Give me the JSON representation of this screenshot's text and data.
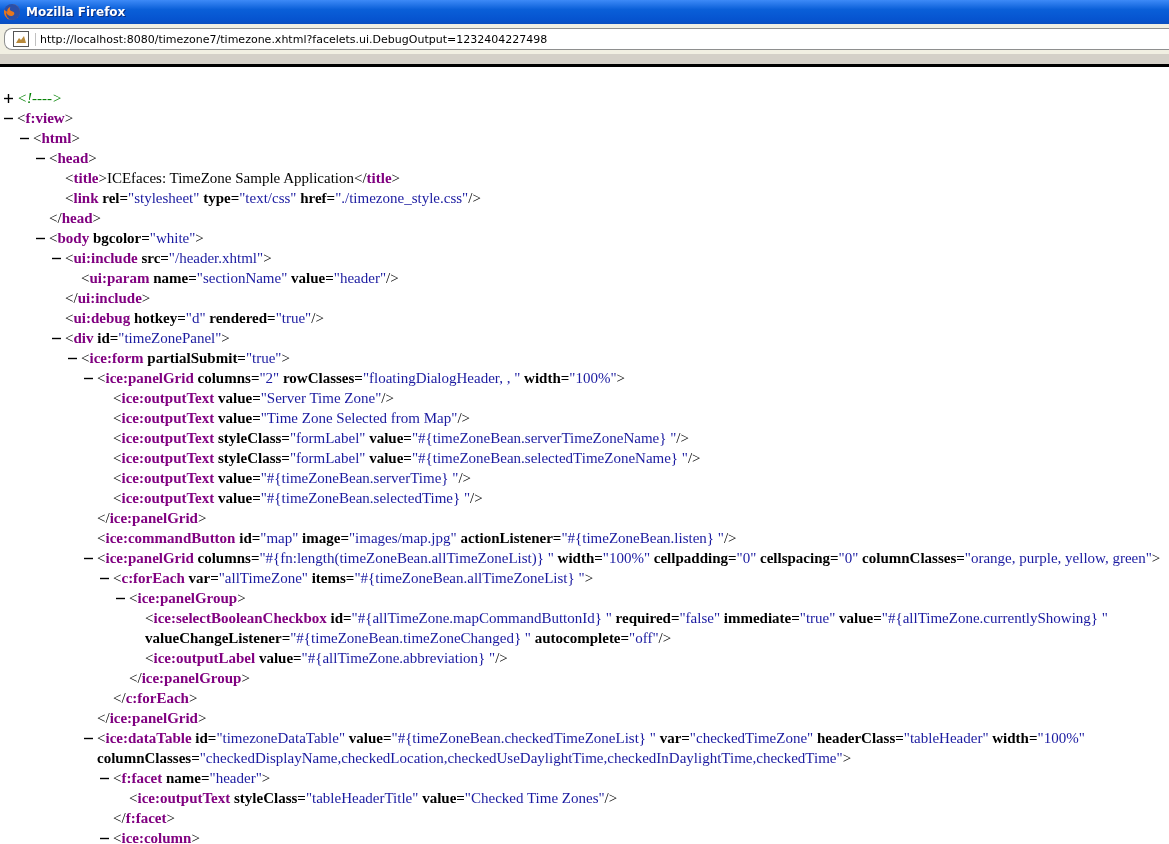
{
  "window": {
    "title": "Mozilla Firefox"
  },
  "address_bar": {
    "value": "http://localhost:8080/timezone7/timezone.xhtml?facelets.ui.DebugOutput=1232404227498"
  },
  "tree": [
    {
      "kind": "comment",
      "expanded": false,
      "open": [
        {
          "comment": "<!---->"
        }
      ]
    },
    {
      "kind": "element",
      "expanded": true,
      "open": [
        {
          "punct": "<"
        },
        {
          "tag": "f:view"
        },
        {
          "punct": ">"
        }
      ],
      "children": [
        {
          "kind": "element",
          "expanded": true,
          "open": [
            {
              "punct": "<"
            },
            {
              "tag": "html"
            },
            {
              "punct": ">"
            }
          ],
          "children": [
            {
              "kind": "element",
              "expanded": true,
              "open": [
                {
                  "punct": "<"
                },
                {
                  "tag": "head"
                },
                {
                  "punct": ">"
                }
              ],
              "children": [
                {
                  "kind": "leaf",
                  "open": [
                    {
                      "punct": "<"
                    },
                    {
                      "tag": "title"
                    },
                    {
                      "punct": ">"
                    },
                    {
                      "text": "ICEfaces: TimeZone Sample Application"
                    },
                    {
                      "punct": "</"
                    },
                    {
                      "tag": "title"
                    },
                    {
                      "punct": ">"
                    }
                  ]
                },
                {
                  "kind": "leaf",
                  "open": [
                    {
                      "punct": "<"
                    },
                    {
                      "tag": "link"
                    },
                    {
                      "attr": "rel="
                    },
                    {
                      "value": "\"stylesheet\""
                    },
                    {
                      "attr": "type="
                    },
                    {
                      "value": "\"text/css\""
                    },
                    {
                      "attr": "href="
                    },
                    {
                      "value": "\"./timezone_style.css\""
                    },
                    {
                      "punct": "/>"
                    }
                  ]
                }
              ],
              "close": [
                {
                  "punct": "</"
                },
                {
                  "tag": "head"
                },
                {
                  "punct": ">"
                }
              ]
            },
            {
              "kind": "element",
              "expanded": true,
              "open": [
                {
                  "punct": "<"
                },
                {
                  "tag": "body"
                },
                {
                  "attr": "bgcolor="
                },
                {
                  "value": "\"white\""
                },
                {
                  "punct": ">"
                }
              ],
              "children": [
                {
                  "kind": "element",
                  "expanded": true,
                  "open": [
                    {
                      "punct": "<"
                    },
                    {
                      "tag": "ui:include"
                    },
                    {
                      "attr": "src="
                    },
                    {
                      "value": "\"/header.xhtml\""
                    },
                    {
                      "punct": ">"
                    }
                  ],
                  "children": [
                    {
                      "kind": "leaf",
                      "open": [
                        {
                          "punct": "<"
                        },
                        {
                          "tag": "ui:param"
                        },
                        {
                          "attr": "name="
                        },
                        {
                          "value": "\"sectionName\""
                        },
                        {
                          "attr": "value="
                        },
                        {
                          "value": "\"header\""
                        },
                        {
                          "punct": "/>"
                        }
                      ]
                    }
                  ],
                  "close": [
                    {
                      "punct": "</"
                    },
                    {
                      "tag": "ui:include"
                    },
                    {
                      "punct": ">"
                    }
                  ]
                },
                {
                  "kind": "leaf",
                  "open": [
                    {
                      "punct": "<"
                    },
                    {
                      "tag": "ui:debug"
                    },
                    {
                      "attr": "hotkey="
                    },
                    {
                      "value": "\"d\""
                    },
                    {
                      "attr": "rendered="
                    },
                    {
                      "value": "\"true\""
                    },
                    {
                      "punct": "/>"
                    }
                  ]
                },
                {
                  "kind": "element",
                  "expanded": true,
                  "open": [
                    {
                      "punct": "<"
                    },
                    {
                      "tag": "div"
                    },
                    {
                      "attr": "id="
                    },
                    {
                      "value": "\"timeZonePanel\""
                    },
                    {
                      "punct": ">"
                    }
                  ],
                  "children": [
                    {
                      "kind": "element",
                      "expanded": true,
                      "open": [
                        {
                          "punct": "<"
                        },
                        {
                          "tag": "ice:form"
                        },
                        {
                          "attr": "partialSubmit="
                        },
                        {
                          "value": "\"true\""
                        },
                        {
                          "punct": ">"
                        }
                      ],
                      "children": [
                        {
                          "kind": "element",
                          "expanded": true,
                          "open": [
                            {
                              "punct": "<"
                            },
                            {
                              "tag": "ice:panelGrid"
                            },
                            {
                              "attr": "columns="
                            },
                            {
                              "value": "\"2\""
                            },
                            {
                              "attr": "rowClasses="
                            },
                            {
                              "value": "\"floatingDialogHeader, , \""
                            },
                            {
                              "attr": "width="
                            },
                            {
                              "value": "\"100%\""
                            },
                            {
                              "punct": ">"
                            }
                          ],
                          "children": [
                            {
                              "kind": "leaf",
                              "open": [
                                {
                                  "punct": "<"
                                },
                                {
                                  "tag": "ice:outputText"
                                },
                                {
                                  "attr": "value="
                                },
                                {
                                  "value": "\"Server Time Zone\""
                                },
                                {
                                  "punct": "/>"
                                }
                              ]
                            },
                            {
                              "kind": "leaf",
                              "open": [
                                {
                                  "punct": "<"
                                },
                                {
                                  "tag": "ice:outputText"
                                },
                                {
                                  "attr": "value="
                                },
                                {
                                  "value": "\"Time Zone Selected from Map\""
                                },
                                {
                                  "punct": "/>"
                                }
                              ]
                            },
                            {
                              "kind": "leaf",
                              "open": [
                                {
                                  "punct": "<"
                                },
                                {
                                  "tag": "ice:outputText"
                                },
                                {
                                  "attr": "styleClass="
                                },
                                {
                                  "value": "\"formLabel\""
                                },
                                {
                                  "attr": "value="
                                },
                                {
                                  "value": "\"#{timeZoneBean.serverTimeZoneName} \""
                                },
                                {
                                  "punct": "/>"
                                }
                              ]
                            },
                            {
                              "kind": "leaf",
                              "open": [
                                {
                                  "punct": "<"
                                },
                                {
                                  "tag": "ice:outputText"
                                },
                                {
                                  "attr": "styleClass="
                                },
                                {
                                  "value": "\"formLabel\""
                                },
                                {
                                  "attr": "value="
                                },
                                {
                                  "value": "\"#{timeZoneBean.selectedTimeZoneName} \""
                                },
                                {
                                  "punct": "/>"
                                }
                              ]
                            },
                            {
                              "kind": "leaf",
                              "open": [
                                {
                                  "punct": "<"
                                },
                                {
                                  "tag": "ice:outputText"
                                },
                                {
                                  "attr": "value="
                                },
                                {
                                  "value": "\"#{timeZoneBean.serverTime} \""
                                },
                                {
                                  "punct": "/>"
                                }
                              ]
                            },
                            {
                              "kind": "leaf",
                              "open": [
                                {
                                  "punct": "<"
                                },
                                {
                                  "tag": "ice:outputText"
                                },
                                {
                                  "attr": "value="
                                },
                                {
                                  "value": "\"#{timeZoneBean.selectedTime} \""
                                },
                                {
                                  "punct": "/>"
                                }
                              ]
                            }
                          ],
                          "close": [
                            {
                              "punct": "</"
                            },
                            {
                              "tag": "ice:panelGrid"
                            },
                            {
                              "punct": ">"
                            }
                          ]
                        },
                        {
                          "kind": "leaf",
                          "open": [
                            {
                              "punct": "<"
                            },
                            {
                              "tag": "ice:commandButton"
                            },
                            {
                              "attr": "id="
                            },
                            {
                              "value": "\"map\""
                            },
                            {
                              "attr": "image="
                            },
                            {
                              "value": "\"images/map.jpg\""
                            },
                            {
                              "attr": "actionListener="
                            },
                            {
                              "value": "\"#{timeZoneBean.listen} \""
                            },
                            {
                              "punct": "/>"
                            }
                          ]
                        },
                        {
                          "kind": "element",
                          "expanded": true,
                          "open": [
                            {
                              "punct": "<"
                            },
                            {
                              "tag": "ice:panelGrid"
                            },
                            {
                              "attr": "columns="
                            },
                            {
                              "value": "\"#{fn:length(timeZoneBean.allTimeZoneList)} \""
                            },
                            {
                              "attr": "width="
                            },
                            {
                              "value": "\"100%\""
                            },
                            {
                              "attr": "cellpadding="
                            },
                            {
                              "value": "\"0\""
                            },
                            {
                              "attr": "cellspacing="
                            },
                            {
                              "value": "\"0\""
                            },
                            {
                              "attr": "columnClasses="
                            },
                            {
                              "value": "\"orange, purple, yellow, green\""
                            },
                            {
                              "punct": ">"
                            }
                          ],
                          "children": [
                            {
                              "kind": "element",
                              "expanded": true,
                              "open": [
                                {
                                  "punct": "<"
                                },
                                {
                                  "tag": "c:forEach"
                                },
                                {
                                  "attr": "var="
                                },
                                {
                                  "value": "\"allTimeZone\""
                                },
                                {
                                  "attr": "items="
                                },
                                {
                                  "value": "\"#{timeZoneBean.allTimeZoneList} \""
                                },
                                {
                                  "punct": ">"
                                }
                              ],
                              "children": [
                                {
                                  "kind": "element",
                                  "expanded": true,
                                  "open": [
                                    {
                                      "punct": "<"
                                    },
                                    {
                                      "tag": "ice:panelGroup"
                                    },
                                    {
                                      "punct": ">"
                                    }
                                  ],
                                  "children": [
                                    {
                                      "kind": "leaf",
                                      "open": [
                                        {
                                          "punct": "<"
                                        },
                                        {
                                          "tag": "ice:selectBooleanCheckbox"
                                        },
                                        {
                                          "attr": "id="
                                        },
                                        {
                                          "value": "\"#{allTimeZone.mapCommandButtonId} \""
                                        },
                                        {
                                          "attr": "required="
                                        },
                                        {
                                          "value": "\"false\""
                                        },
                                        {
                                          "attr": "immediate="
                                        },
                                        {
                                          "value": "\"true\""
                                        },
                                        {
                                          "attr": "value="
                                        },
                                        {
                                          "value": "\"#{allTimeZone.currentlyShowing} \""
                                        },
                                        {
                                          "attr": "valueChangeListener="
                                        },
                                        {
                                          "value": "\"#{timeZoneBean.timeZoneChanged} \""
                                        },
                                        {
                                          "attr": "autocomplete="
                                        },
                                        {
                                          "value": "\"off\""
                                        },
                                        {
                                          "punct": "/>"
                                        }
                                      ]
                                    },
                                    {
                                      "kind": "leaf",
                                      "open": [
                                        {
                                          "punct": "<"
                                        },
                                        {
                                          "tag": "ice:outputLabel"
                                        },
                                        {
                                          "attr": "value="
                                        },
                                        {
                                          "value": "\"#{allTimeZone.abbreviation} \""
                                        },
                                        {
                                          "punct": "/>"
                                        }
                                      ]
                                    }
                                  ],
                                  "close": [
                                    {
                                      "punct": "</"
                                    },
                                    {
                                      "tag": "ice:panelGroup"
                                    },
                                    {
                                      "punct": ">"
                                    }
                                  ]
                                }
                              ],
                              "close": [
                                {
                                  "punct": "</"
                                },
                                {
                                  "tag": "c:forEach"
                                },
                                {
                                  "punct": ">"
                                }
                              ]
                            }
                          ],
                          "close": [
                            {
                              "punct": "</"
                            },
                            {
                              "tag": "ice:panelGrid"
                            },
                            {
                              "punct": ">"
                            }
                          ]
                        },
                        {
                          "kind": "element",
                          "expanded": true,
                          "open": [
                            {
                              "punct": "<"
                            },
                            {
                              "tag": "ice:dataTable"
                            },
                            {
                              "attr": "id="
                            },
                            {
                              "value": "\"timezoneDataTable\""
                            },
                            {
                              "attr": "value="
                            },
                            {
                              "value": "\"#{timeZoneBean.checkedTimeZoneList} \""
                            },
                            {
                              "attr": "var="
                            },
                            {
                              "value": "\"checkedTimeZone\""
                            },
                            {
                              "attr": "headerClass="
                            },
                            {
                              "value": "\"tableHeader\""
                            },
                            {
                              "attr": "width="
                            },
                            {
                              "value": "\"100%\""
                            },
                            {
                              "attr": "columnClasses="
                            },
                            {
                              "value": "\"checkedDisplayName,checkedLocation,checkedUseDaylightTime,checkedInDaylightTime,checkedTime\""
                            },
                            {
                              "punct": ">"
                            }
                          ],
                          "children": [
                            {
                              "kind": "element",
                              "expanded": true,
                              "open": [
                                {
                                  "punct": "<"
                                },
                                {
                                  "tag": "f:facet"
                                },
                                {
                                  "attr": "name="
                                },
                                {
                                  "value": "\"header\""
                                },
                                {
                                  "punct": ">"
                                }
                              ],
                              "children": [
                                {
                                  "kind": "leaf",
                                  "open": [
                                    {
                                      "punct": "<"
                                    },
                                    {
                                      "tag": "ice:outputText"
                                    },
                                    {
                                      "attr": "styleClass="
                                    },
                                    {
                                      "value": "\"tableHeaderTitle\""
                                    },
                                    {
                                      "attr": "value="
                                    },
                                    {
                                      "value": "\"Checked Time Zones\""
                                    },
                                    {
                                      "punct": "/>"
                                    }
                                  ]
                                }
                              ],
                              "close": [
                                {
                                  "punct": "</"
                                },
                                {
                                  "tag": "f:facet"
                                },
                                {
                                  "punct": ">"
                                }
                              ]
                            },
                            {
                              "kind": "element",
                              "expanded": true,
                              "open": [
                                {
                                  "punct": "<"
                                },
                                {
                                  "tag": "ice:column"
                                },
                                {
                                  "punct": ">"
                                }
                              ]
                            }
                          ]
                        }
                      ]
                    }
                  ]
                }
              ]
            }
          ]
        }
      ]
    }
  ]
}
